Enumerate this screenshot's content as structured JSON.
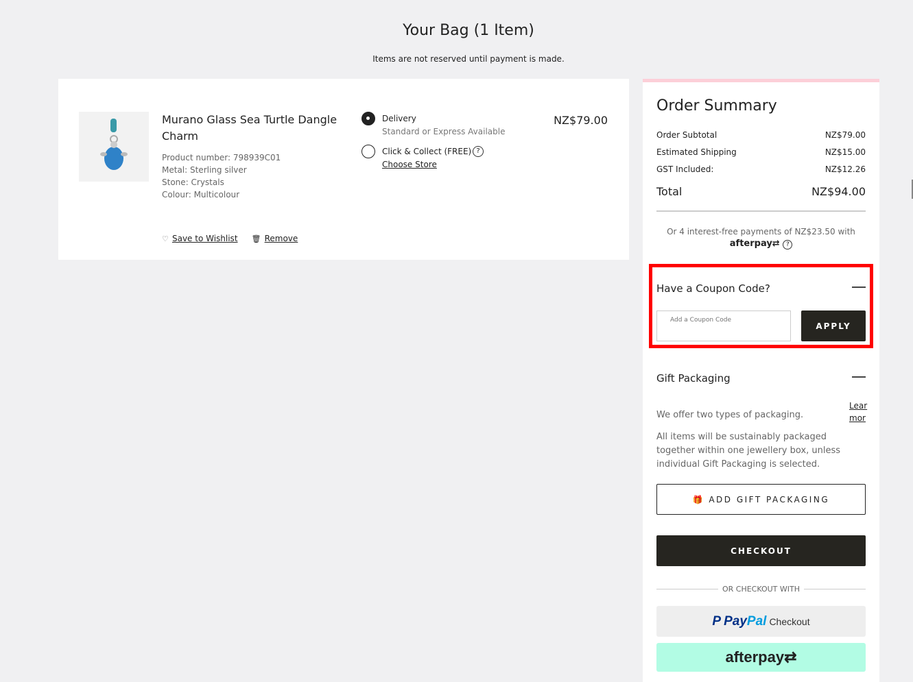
{
  "header": {
    "title": "Your Bag (1 Item)",
    "subtitle": "Items are not reserved until payment is made."
  },
  "item": {
    "name": "Murano Glass Sea Turtle Dangle Charm",
    "attributes": [
      "Product number: 798939C01",
      "Metal: Sterling silver",
      "Stone: Crystals",
      "Colour: Multicolour"
    ],
    "price": "NZ$79.00",
    "wishlist": "Save to Wishlist",
    "remove": "Remove",
    "delivery": {
      "label": "Delivery",
      "desc": "Standard or Express Available",
      "selected": true
    },
    "collect": {
      "label": "Click & Collect (FREE)",
      "link": "Choose Store",
      "selected": false
    }
  },
  "summary": {
    "title": "Order Summary",
    "rows": [
      {
        "label": "Order Subtotal",
        "value": "NZ$79.00"
      },
      {
        "label": "Estimated Shipping",
        "value": "NZ$15.00"
      },
      {
        "label": "GST Included:",
        "value": "NZ$12.26"
      }
    ],
    "total_label": "Total",
    "total_value": "NZ$94.00",
    "afterpay_text": "Or 4 interest-free payments of NZ$23.50 with",
    "afterpay_logo": "afterpay"
  },
  "coupon": {
    "title": "Have a Coupon Code?",
    "placeholder": "Add a Coupon Code",
    "apply": "APPLY",
    "highlight_color": "#ff0000"
  },
  "gift": {
    "title": "Gift Packaging",
    "learn_more_1": "Lear",
    "learn_more_2": "mor",
    "text1": "We offer two types of packaging.",
    "text2": "All items will be sustainably packaged together within one jewellery box, unless individual Gift Packaging is selected.",
    "button": "ADD GIFT PACKAGING"
  },
  "checkout": {
    "button": "CHECKOUT",
    "or": "OR CHECKOUT WITH",
    "paypal_p": "Pay",
    "paypal_pal": "Pal",
    "paypal_checkout": "Checkout",
    "afterpay": "afterpay"
  }
}
